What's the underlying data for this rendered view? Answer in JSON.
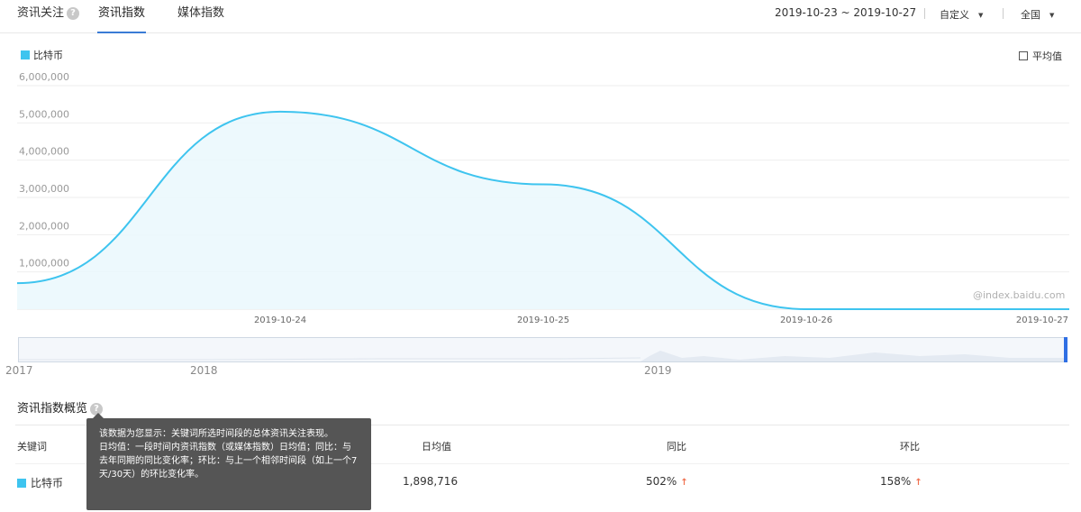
{
  "header": {
    "tabs": [
      {
        "label": "资讯关注",
        "active": false,
        "has_help": true
      },
      {
        "label": "资讯指数",
        "active": true
      },
      {
        "label": "媒体指数",
        "active": false
      }
    ],
    "date_range": "2019-10-23 ~ 2019-10-27",
    "period_select": "自定义",
    "region_select": "全国"
  },
  "legend": {
    "label": "比特币",
    "color": "#3ec4ef"
  },
  "average_toggle": {
    "label": "平均值",
    "checked": false
  },
  "watermark": "@index.baidu.com",
  "chart_data": {
    "type": "area",
    "title": "",
    "xlabel": "",
    "ylabel": "",
    "x": [
      "2019-10-23",
      "2019-10-24",
      "2019-10-25",
      "2019-10-26",
      "2019-10-27"
    ],
    "x_tick_labels": [
      "2019-10-24",
      "2019-10-25",
      "2019-10-26",
      "2019-10-27"
    ],
    "y_tick_labels": [
      "1,000,000",
      "2,000,000",
      "3,000,000",
      "4,000,000",
      "5,000,000",
      "6,000,000"
    ],
    "ylim": [
      0,
      6000000
    ],
    "series": [
      {
        "name": "比特币",
        "values": [
          700000,
          5300000,
          3350000,
          0,
          0
        ],
        "color": "#3ec4ef"
      }
    ],
    "grid": true,
    "legend": "top-left"
  },
  "navigator": {
    "years": [
      "2017",
      "2018",
      "2019"
    ]
  },
  "overview": {
    "title": "资讯指数概览",
    "columns": [
      "关键词",
      "日均值",
      "同比",
      "环比"
    ],
    "rows": [
      {
        "keyword": "比特币",
        "daily_avg": "1,898,716",
        "yoy": "502%",
        "mom": "158%"
      }
    ]
  },
  "tooltip": {
    "line1": "该数据为您显示：关键词所选时间段的总体资讯关注表现。",
    "line2": "日均值：一段时间内资讯指数（或媒体指数）日均值；同比：与去年同期的同比变化率；环比：与上一个相邻时间段（如上一个7天/30天）的环比变化率。"
  }
}
